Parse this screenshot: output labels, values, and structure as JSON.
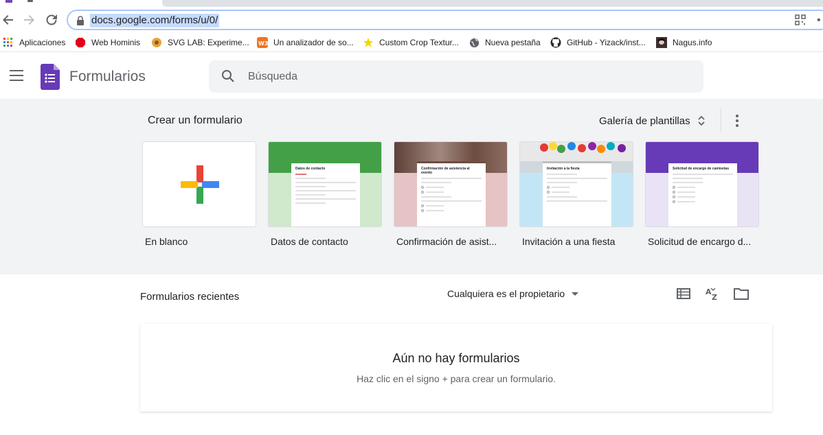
{
  "browser": {
    "url": "docs.google.com/forms/u/0/"
  },
  "bookmarks": [
    {
      "label": "Aplicaciones",
      "icon": "apps-grid-icon"
    },
    {
      "label": "Web Hominis",
      "icon": "red-octagon-icon"
    },
    {
      "label": "SVG LAB: Experime...",
      "icon": "sunflower-icon"
    },
    {
      "label": "Un analizador de so...",
      "icon": "w3-icon"
    },
    {
      "label": "Custom Crop Textur...",
      "icon": "star-yellow-icon"
    },
    {
      "label": "Nueva pestaña",
      "icon": "globe-icon"
    },
    {
      "label": "GitHub - Yizack/inst...",
      "icon": "github-icon"
    },
    {
      "label": "Nagus.info",
      "icon": "avatar-icon"
    }
  ],
  "app": {
    "title": "Formularios",
    "search_placeholder": "Búsqueda"
  },
  "gallery": {
    "title": "Crear un formulario",
    "gallery_button": "Galería de plantillas",
    "templates": [
      {
        "label": "En blanco"
      },
      {
        "label": "Datos de contacto",
        "mini_title": "Datos de contacto",
        "color": "#43a047",
        "bg": "#d0e8cc"
      },
      {
        "label": "Confirmación de asist...",
        "mini_title": "Confirmación de asistencia al evento",
        "color": "#6d4c41",
        "bg": "#e6c3c5"
      },
      {
        "label": "Invitación a una fiesta",
        "mini_title": "Invitación a la fiesta",
        "color": "#bdbdbd",
        "bg": "#c3e6f7"
      },
      {
        "label": "Solicitud de encargo d...",
        "mini_title": "Solicitud de encargo de camisetas",
        "color": "#673ab7",
        "bg": "#e9e3f5"
      }
    ]
  },
  "recent": {
    "title": "Formularios recientes",
    "owner_filter": "Cualquiera es el propietario",
    "empty_title": "Aún no hay formularios",
    "empty_sub": "Haz clic en el signo + para crear un formulario."
  },
  "colors": {
    "forms_purple": "#673ab7",
    "gallery_bg": "#f1f3f4"
  }
}
